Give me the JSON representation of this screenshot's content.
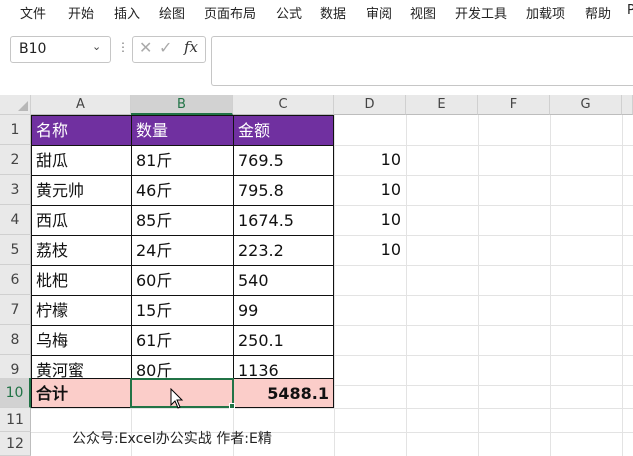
{
  "ribbon": {
    "tabs": [
      "文件",
      "开始",
      "插入",
      "绘图",
      "页面布局",
      "公式",
      "数据",
      "审阅",
      "视图",
      "开发工具",
      "加载项",
      "帮助",
      "P"
    ]
  },
  "formula_bar": {
    "name_box": "B10",
    "fx_label": "fx",
    "formula": ""
  },
  "columns": [
    "A",
    "B",
    "C",
    "D",
    "E",
    "F",
    "G"
  ],
  "rows": [
    "1",
    "2",
    "3",
    "4",
    "5",
    "6",
    "7",
    "8",
    "9",
    "10",
    "11",
    "12"
  ],
  "table": {
    "header": [
      "名称",
      "数量",
      "金额"
    ],
    "data": [
      [
        "甜瓜",
        "81斤",
        "769.5"
      ],
      [
        "黄元帅",
        "46斤",
        "795.8"
      ],
      [
        "西瓜",
        "85斤",
        "1674.5"
      ],
      [
        "荔枝",
        "24斤",
        "223.2"
      ],
      [
        "枇杷",
        "60斤",
        "540"
      ],
      [
        "柠檬",
        "15斤",
        "99"
      ],
      [
        "乌梅",
        "61斤",
        "250.1"
      ],
      [
        "黄河蜜",
        "80斤",
        "1136"
      ]
    ],
    "total_label": "合计",
    "total_qty": "",
    "total_amount": "5488.1"
  },
  "column_d": [
    "10",
    "10",
    "10",
    "10"
  ],
  "selected_cell": "B10",
  "note": "公众号:Excel办公实战 作者:E精",
  "colors": {
    "header_fill": "#7030a0",
    "total_fill": "#fbcdc9",
    "selection": "#217346"
  }
}
